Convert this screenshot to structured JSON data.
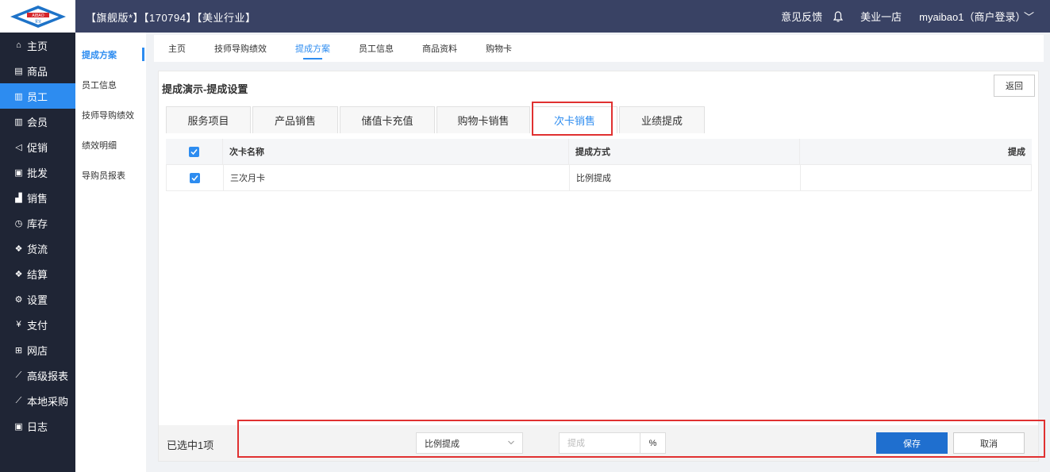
{
  "header": {
    "title": "【旗舰版*】【170794】【美业行业】",
    "logo_text": "AIBAO",
    "logo_sub": "爱宝",
    "feedback": "意见反馈",
    "store": "美业一店",
    "user": "myaibao1（商户登录）"
  },
  "sidebar": {
    "items": [
      {
        "label": "主页",
        "icon": "home-icon"
      },
      {
        "label": "商品",
        "icon": "box-icon"
      },
      {
        "label": "员工",
        "icon": "staff-icon"
      },
      {
        "label": "会员",
        "icon": "member-icon"
      },
      {
        "label": "促销",
        "icon": "promo-icon"
      },
      {
        "label": "批发",
        "icon": "wholesale-icon"
      },
      {
        "label": "销售",
        "icon": "sales-icon"
      },
      {
        "label": "库存",
        "icon": "inventory-icon"
      },
      {
        "label": "货流",
        "icon": "logistics-icon"
      },
      {
        "label": "结算",
        "icon": "settlement-icon"
      },
      {
        "label": "设置",
        "icon": "settings-icon"
      },
      {
        "label": "支付",
        "icon": "payment-icon"
      },
      {
        "label": "网店",
        "icon": "shop-icon"
      },
      {
        "label": "高级报表",
        "icon": "report-icon"
      },
      {
        "label": "本地采购",
        "icon": "purchase-icon"
      },
      {
        "label": "日志",
        "icon": "log-icon"
      }
    ],
    "active_index": 2
  },
  "subsidebar": {
    "items": [
      "提成方案",
      "员工信息",
      "技师导购绩效",
      "绩效明细",
      "导购员报表"
    ]
  },
  "navtabs": {
    "items": [
      "主页",
      "技师导购绩效",
      "提成方案",
      "员工信息",
      "商品资料",
      "购物卡"
    ]
  },
  "panel": {
    "title": "提成演示-提成设置",
    "back_label": "返回"
  },
  "subtabs": {
    "items": [
      "服务项目",
      "产品销售",
      "储值卡充值",
      "购物卡销售",
      "次卡销售",
      "业绩提成"
    ]
  },
  "table": {
    "headers": [
      "次卡名称",
      "提成方式",
      "提成"
    ],
    "rows": [
      {
        "name": "三次月卡",
        "method": "比例提成",
        "commission": ""
      }
    ]
  },
  "footer": {
    "selected_count": "已选中1项",
    "method_select": "比例提成",
    "commission_placeholder": "提成",
    "percent": "%",
    "save_label": "保存",
    "cancel_label": "取消"
  },
  "colors": {
    "topbar": "#394264",
    "sidebar": "#1f2535",
    "accent": "#2d8cf0",
    "highlight_box": "#e03131"
  }
}
